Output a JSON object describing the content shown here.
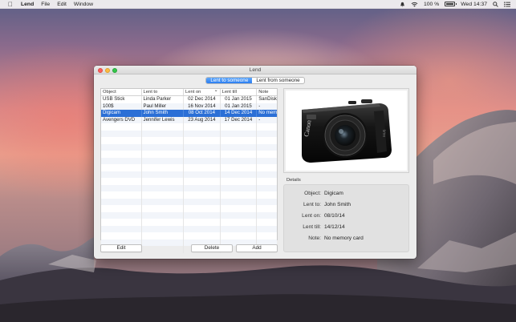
{
  "menubar": {
    "app_name": "Lend",
    "menus": [
      "File",
      "Edit",
      "Window"
    ],
    "battery_text": "100 %",
    "clock": "Wed 14:37"
  },
  "window": {
    "title": "Lend",
    "tabs": [
      {
        "label": "Lent to someone",
        "active": true
      },
      {
        "label": "Lent from someone",
        "active": false
      }
    ]
  },
  "table": {
    "columns": [
      "Object",
      "Lent to",
      "Lent on",
      "Lent till",
      "Note"
    ],
    "sort_column": "Lent on",
    "rows": [
      {
        "object": "USB Stick",
        "lent_to": "Linda Parker",
        "lent_on": "02 Dec 2014",
        "lent_till": "01 Jan 2015",
        "note": "SanDisk",
        "selected": false
      },
      {
        "object": "100$",
        "lent_to": "Paul Miller",
        "lent_on": "16 Nov 2014",
        "lent_till": "01 Jan 2015",
        "note": "-",
        "selected": false
      },
      {
        "object": "Digicam",
        "lent_to": "John Smith",
        "lent_on": "08 Oct 2014",
        "lent_till": "14 Dec 2014",
        "note": "No mem",
        "selected": true
      },
      {
        "object": "Avengers DVD",
        "lent_to": "Jennifer Lewis",
        "lent_on": "23 Aug 2014",
        "lent_till": "17 Dec 2014",
        "note": "-",
        "selected": false
      }
    ],
    "empty_rows": 19
  },
  "buttons": {
    "edit": "Edit",
    "delete": "Delete",
    "add": "Add"
  },
  "details": {
    "section_label": "Details",
    "fields": [
      {
        "key": "Object:",
        "value": "Digicam"
      },
      {
        "key": "Lent to:",
        "value": "John Smith"
      },
      {
        "key": "Lent on:",
        "value": "08/10/14"
      },
      {
        "key": "Lent till:",
        "value": "14/12/14"
      },
      {
        "key": "Note:",
        "value": "No memory card"
      }
    ]
  },
  "colors": {
    "selection": "#2b6fd6",
    "segment_active": "#2b7ef1",
    "close": "#fc605c",
    "minimize": "#fdbc40",
    "maximize": "#34c84a"
  },
  "icons": [
    "apple-icon",
    "notification-icon",
    "wifi-icon",
    "battery-icon",
    "spotlight-icon",
    "notification-center-icon"
  ]
}
